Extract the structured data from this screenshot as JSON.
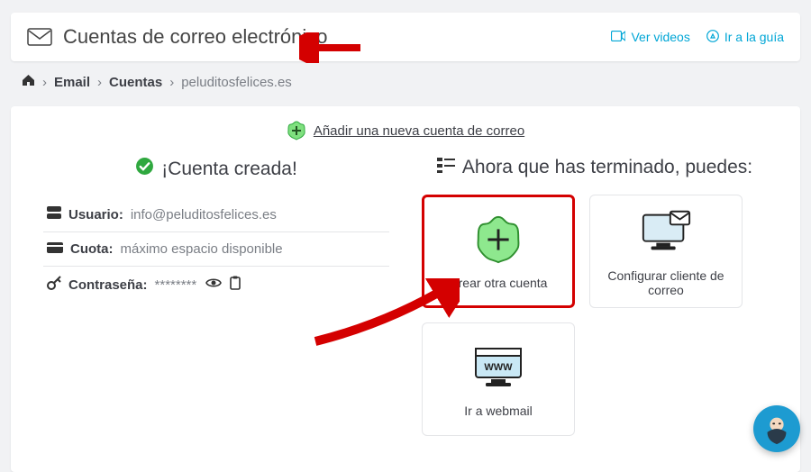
{
  "header": {
    "title": "Cuentas de correo electrónico",
    "watch_videos": "Ver videos",
    "go_guide": "Ir a la guía"
  },
  "breadcrumbs": {
    "email": "Email",
    "accounts": "Cuentas",
    "current": "peluditosfelices.es"
  },
  "add_account": {
    "label": "Añadir una nueva cuenta de correo"
  },
  "created": {
    "heading": "¡Cuenta creada!",
    "user_label": "Usuario:",
    "user_value": "info@peluditosfelices.es",
    "quota_label": "Cuota:",
    "quota_value": "máximo espacio disponible",
    "password_label": "Contraseña:",
    "password_value": "********"
  },
  "next": {
    "heading": "Ahora que has terminado, puedes:",
    "tiles": {
      "create_another": "Crear otra cuenta",
      "configure_client": "Configurar cliente de correo",
      "go_webmail": "Ir a webmail"
    }
  }
}
